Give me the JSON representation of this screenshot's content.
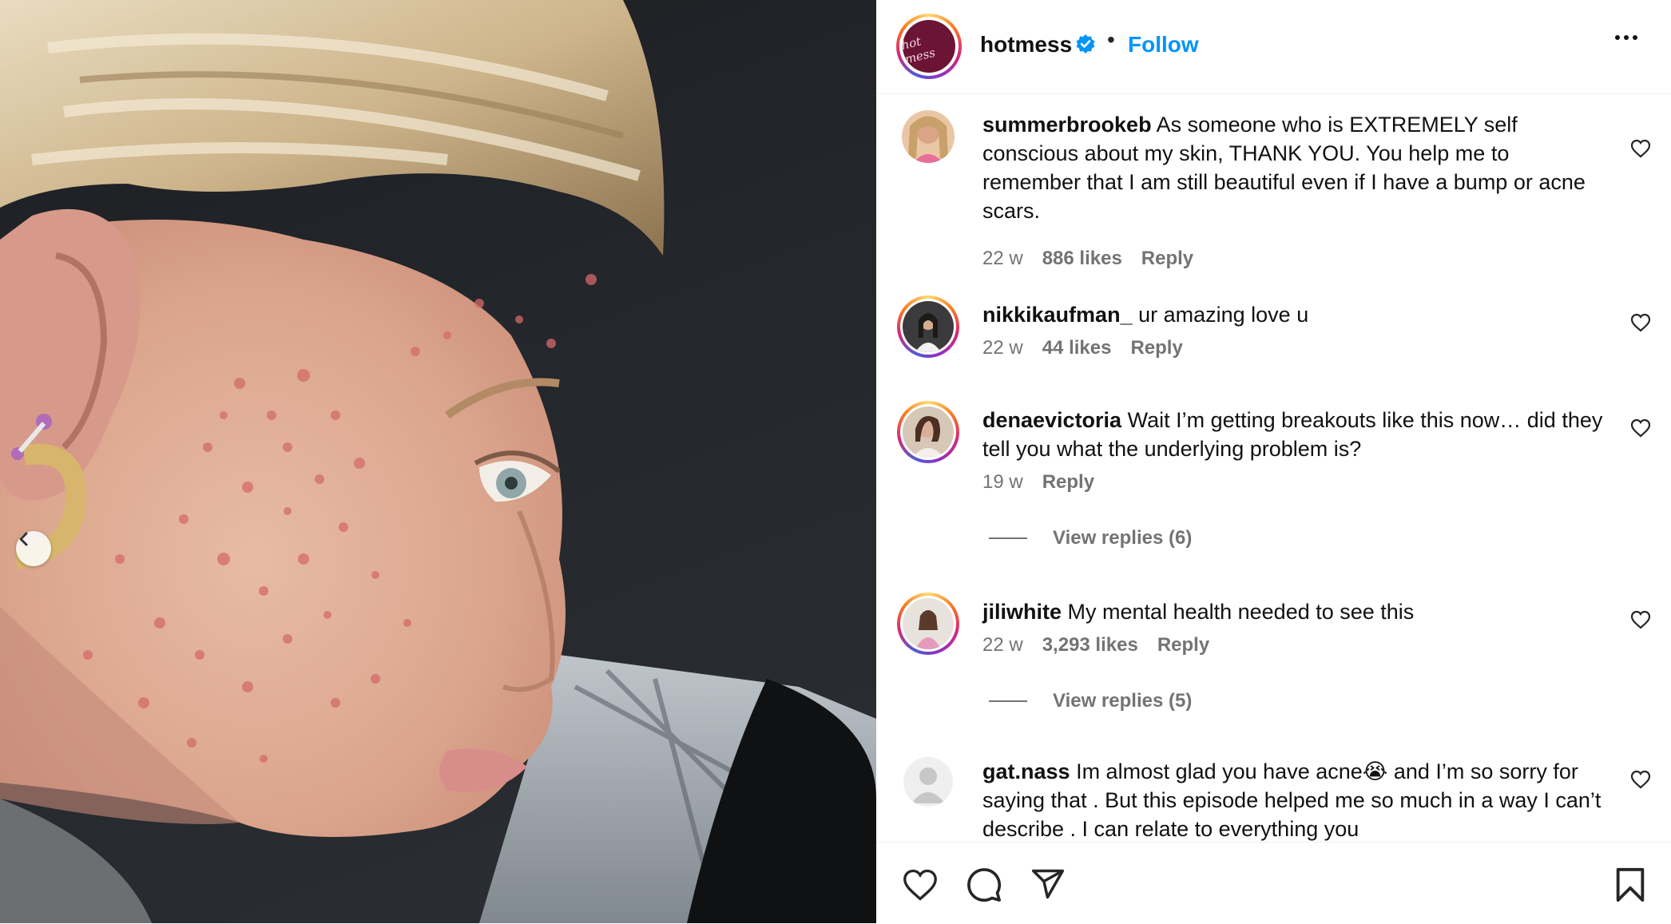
{
  "post": {
    "username": "hotmess",
    "follow_label": "Follow",
    "separator": "•",
    "logo_text": "hot mess",
    "brand_color": "#0095f6"
  },
  "comments": [
    {
      "username": "summerbrookeb",
      "text": "As someone who is EXTREMELY self conscious about my skin, THANK YOU. You help me to remember that I am still beautiful even if I have a bump or acne scars.",
      "age": "22 w",
      "likes": "886 likes",
      "reply_label": "Reply"
    },
    {
      "username": "nikkikaufman_",
      "text": "ur amazing love u",
      "age": "22 w",
      "likes": "44 likes",
      "reply_label": "Reply"
    },
    {
      "username": "denaevictoria",
      "text": "Wait I’m getting breakouts like this now… did they tell you what the underlying problem is?",
      "age": "19 w",
      "reply_label": "Reply",
      "view_replies": "View replies (6)"
    },
    {
      "username": "jiliwhite",
      "text": "My mental health needed to see this",
      "age": "22 w",
      "likes": "3,293 likes",
      "reply_label": "Reply",
      "view_replies": "View replies (5)"
    },
    {
      "username": "gat.nass",
      "text_before_emoji": "Im almost glad you have acne",
      "emoji": "😭",
      "text_after_emoji": " and I’m so sorry for saying that . But this episode helped me so much in a way I can’t describe . I can relate to everything you"
    }
  ],
  "icons": {
    "header": [
      "verified-badge-icon",
      "more-options-icon"
    ],
    "comment": "heart-icon",
    "actions": [
      "like-icon",
      "comment-icon",
      "share-icon",
      "save-icon"
    ],
    "photo": "chevron-left-icon"
  }
}
